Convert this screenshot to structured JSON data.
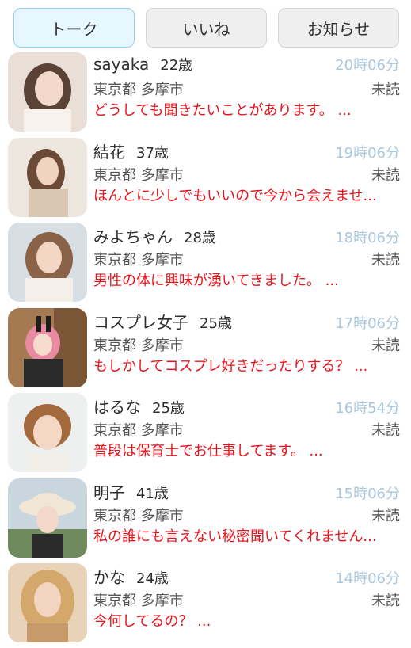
{
  "tabs": [
    {
      "label": "トーク",
      "active": true
    },
    {
      "label": "いいね",
      "active": false
    },
    {
      "label": "お知らせ",
      "active": false
    }
  ],
  "colors": {
    "time": "#a9c8de",
    "message": "#e8141c",
    "active_tab": "#e6f7ff"
  },
  "conversations": [
    {
      "name": "sayaka",
      "age": "22歳",
      "time": "20時06分",
      "location": "東京都 多摩市",
      "status": "未読",
      "message": "どうしても聞きたいことがあります。 ..."
    },
    {
      "name": "結花",
      "age": "37歳",
      "time": "19時06分",
      "location": "東京都 多摩市",
      "status": "未読",
      "message": "ほんとに少しでもいいので今から会えませ..."
    },
    {
      "name": "みよちゃん",
      "age": "28歳",
      "time": "18時06分",
      "location": "東京都 多摩市",
      "status": "未読",
      "message": "男性の体に興味が湧いてきました。 ..."
    },
    {
      "name": "コスプレ女子",
      "age": "25歳",
      "time": "17時06分",
      "location": "東京都 多摩市",
      "status": "未読",
      "message": "もしかしてコスプレ好きだったりする？ ..."
    },
    {
      "name": "はるな",
      "age": "25歳",
      "time": "16時54分",
      "location": "東京都 多摩市",
      "status": "未読",
      "message": "普段は保育士でお仕事してます。 ..."
    },
    {
      "name": "明子",
      "age": "41歳",
      "time": "15時06分",
      "location": "東京都 多摩市",
      "status": "未読",
      "message": "私の誰にも言えない秘密聞いてくれません..."
    },
    {
      "name": "かな",
      "age": "24歳",
      "time": "14時06分",
      "location": "東京都 多摩市",
      "status": "未読",
      "message": "今何してるの？ ..."
    }
  ]
}
